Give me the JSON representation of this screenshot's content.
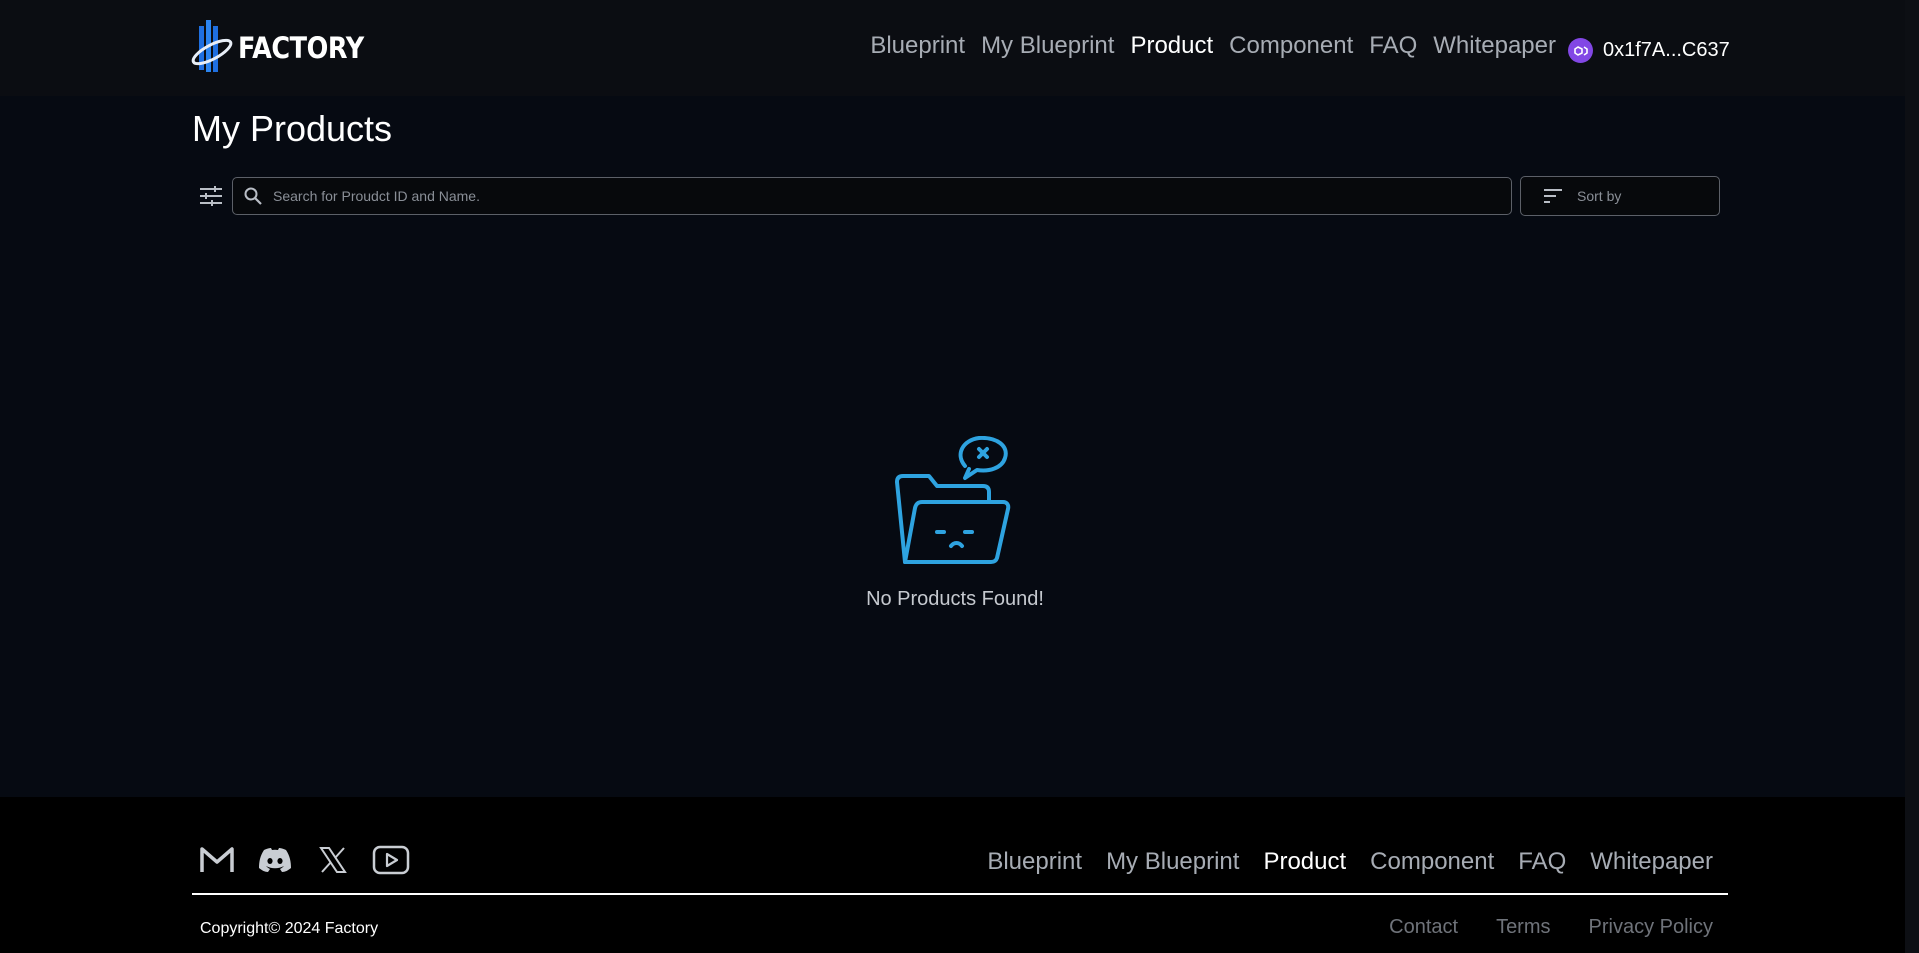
{
  "header": {
    "logo_text": "FACTORY",
    "nav": [
      {
        "label": "Blueprint",
        "active": false
      },
      {
        "label": "My Blueprint",
        "active": false
      },
      {
        "label": "Product",
        "active": true
      },
      {
        "label": "Component",
        "active": false
      },
      {
        "label": "FAQ",
        "active": false
      },
      {
        "label": "Whitepaper",
        "active": false
      }
    ],
    "wallet": {
      "address": "0x1f7A...C637",
      "icon": "polygon-icon"
    }
  },
  "main": {
    "title": "My Products",
    "filter_icon": "sliders-icon",
    "search": {
      "placeholder": "Search for Proudct ID and Name.",
      "value": ""
    },
    "sort": {
      "label": "Sort by",
      "icon": "sort-icon"
    },
    "empty_state": {
      "message": "No Products Found!",
      "icon": "empty-folder-icon"
    }
  },
  "footer": {
    "socials": [
      {
        "name": "gmail-icon"
      },
      {
        "name": "discord-icon"
      },
      {
        "name": "x-icon"
      },
      {
        "name": "youtube-icon"
      }
    ],
    "nav": [
      {
        "label": "Blueprint",
        "active": false
      },
      {
        "label": "My Blueprint",
        "active": false
      },
      {
        "label": "Product",
        "active": true
      },
      {
        "label": "Component",
        "active": false
      },
      {
        "label": "FAQ",
        "active": false
      },
      {
        "label": "Whitepaper",
        "active": false
      }
    ],
    "copyright": "Copyright© 2024 Factory",
    "legal": [
      "Contact",
      "Terms",
      "Privacy Policy"
    ]
  },
  "colors": {
    "background": "#060a12",
    "header_bg": "#0b0d12",
    "footer_bg": "#000000",
    "accent_blue": "#2ea3e0",
    "wallet_purple": "#8247e5",
    "nav_inactive": "#a7acb4"
  }
}
